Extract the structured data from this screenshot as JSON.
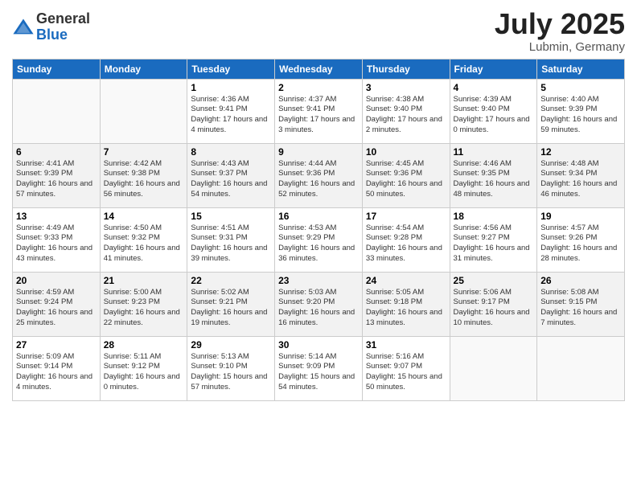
{
  "logo": {
    "general": "General",
    "blue": "Blue"
  },
  "title": "July 2025",
  "subtitle": "Lubmin, Germany",
  "weekdays": [
    "Sunday",
    "Monday",
    "Tuesday",
    "Wednesday",
    "Thursday",
    "Friday",
    "Saturday"
  ],
  "weeks": [
    [
      {
        "day": "",
        "info": ""
      },
      {
        "day": "",
        "info": ""
      },
      {
        "day": "1",
        "info": "Sunrise: 4:36 AM\nSunset: 9:41 PM\nDaylight: 17 hours\nand 4 minutes."
      },
      {
        "day": "2",
        "info": "Sunrise: 4:37 AM\nSunset: 9:41 PM\nDaylight: 17 hours\nand 3 minutes."
      },
      {
        "day": "3",
        "info": "Sunrise: 4:38 AM\nSunset: 9:40 PM\nDaylight: 17 hours\nand 2 minutes."
      },
      {
        "day": "4",
        "info": "Sunrise: 4:39 AM\nSunset: 9:40 PM\nDaylight: 17 hours\nand 0 minutes."
      },
      {
        "day": "5",
        "info": "Sunrise: 4:40 AM\nSunset: 9:39 PM\nDaylight: 16 hours\nand 59 minutes."
      }
    ],
    [
      {
        "day": "6",
        "info": "Sunrise: 4:41 AM\nSunset: 9:39 PM\nDaylight: 16 hours\nand 57 minutes."
      },
      {
        "day": "7",
        "info": "Sunrise: 4:42 AM\nSunset: 9:38 PM\nDaylight: 16 hours\nand 56 minutes."
      },
      {
        "day": "8",
        "info": "Sunrise: 4:43 AM\nSunset: 9:37 PM\nDaylight: 16 hours\nand 54 minutes."
      },
      {
        "day": "9",
        "info": "Sunrise: 4:44 AM\nSunset: 9:36 PM\nDaylight: 16 hours\nand 52 minutes."
      },
      {
        "day": "10",
        "info": "Sunrise: 4:45 AM\nSunset: 9:36 PM\nDaylight: 16 hours\nand 50 minutes."
      },
      {
        "day": "11",
        "info": "Sunrise: 4:46 AM\nSunset: 9:35 PM\nDaylight: 16 hours\nand 48 minutes."
      },
      {
        "day": "12",
        "info": "Sunrise: 4:48 AM\nSunset: 9:34 PM\nDaylight: 16 hours\nand 46 minutes."
      }
    ],
    [
      {
        "day": "13",
        "info": "Sunrise: 4:49 AM\nSunset: 9:33 PM\nDaylight: 16 hours\nand 43 minutes."
      },
      {
        "day": "14",
        "info": "Sunrise: 4:50 AM\nSunset: 9:32 PM\nDaylight: 16 hours\nand 41 minutes."
      },
      {
        "day": "15",
        "info": "Sunrise: 4:51 AM\nSunset: 9:31 PM\nDaylight: 16 hours\nand 39 minutes."
      },
      {
        "day": "16",
        "info": "Sunrise: 4:53 AM\nSunset: 9:29 PM\nDaylight: 16 hours\nand 36 minutes."
      },
      {
        "day": "17",
        "info": "Sunrise: 4:54 AM\nSunset: 9:28 PM\nDaylight: 16 hours\nand 33 minutes."
      },
      {
        "day": "18",
        "info": "Sunrise: 4:56 AM\nSunset: 9:27 PM\nDaylight: 16 hours\nand 31 minutes."
      },
      {
        "day": "19",
        "info": "Sunrise: 4:57 AM\nSunset: 9:26 PM\nDaylight: 16 hours\nand 28 minutes."
      }
    ],
    [
      {
        "day": "20",
        "info": "Sunrise: 4:59 AM\nSunset: 9:24 PM\nDaylight: 16 hours\nand 25 minutes."
      },
      {
        "day": "21",
        "info": "Sunrise: 5:00 AM\nSunset: 9:23 PM\nDaylight: 16 hours\nand 22 minutes."
      },
      {
        "day": "22",
        "info": "Sunrise: 5:02 AM\nSunset: 9:21 PM\nDaylight: 16 hours\nand 19 minutes."
      },
      {
        "day": "23",
        "info": "Sunrise: 5:03 AM\nSunset: 9:20 PM\nDaylight: 16 hours\nand 16 minutes."
      },
      {
        "day": "24",
        "info": "Sunrise: 5:05 AM\nSunset: 9:18 PM\nDaylight: 16 hours\nand 13 minutes."
      },
      {
        "day": "25",
        "info": "Sunrise: 5:06 AM\nSunset: 9:17 PM\nDaylight: 16 hours\nand 10 minutes."
      },
      {
        "day": "26",
        "info": "Sunrise: 5:08 AM\nSunset: 9:15 PM\nDaylight: 16 hours\nand 7 minutes."
      }
    ],
    [
      {
        "day": "27",
        "info": "Sunrise: 5:09 AM\nSunset: 9:14 PM\nDaylight: 16 hours\nand 4 minutes."
      },
      {
        "day": "28",
        "info": "Sunrise: 5:11 AM\nSunset: 9:12 PM\nDaylight: 16 hours\nand 0 minutes."
      },
      {
        "day": "29",
        "info": "Sunrise: 5:13 AM\nSunset: 9:10 PM\nDaylight: 15 hours\nand 57 minutes."
      },
      {
        "day": "30",
        "info": "Sunrise: 5:14 AM\nSunset: 9:09 PM\nDaylight: 15 hours\nand 54 minutes."
      },
      {
        "day": "31",
        "info": "Sunrise: 5:16 AM\nSunset: 9:07 PM\nDaylight: 15 hours\nand 50 minutes."
      },
      {
        "day": "",
        "info": ""
      },
      {
        "day": "",
        "info": ""
      }
    ]
  ]
}
